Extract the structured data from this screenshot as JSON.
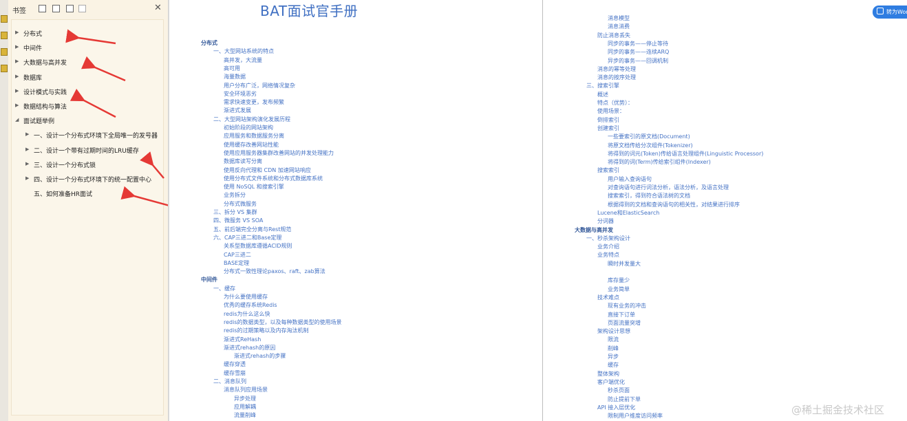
{
  "sidebar": {
    "title": "书签",
    "items": [
      {
        "label": "分布式",
        "expand": "closed",
        "level": 0
      },
      {
        "label": "中间件",
        "expand": "closed",
        "level": 0
      },
      {
        "label": "大数据与高并发",
        "expand": "closed",
        "level": 0
      },
      {
        "label": "数据库",
        "expand": "closed",
        "level": 0
      },
      {
        "label": "设计模式与实践",
        "expand": "closed",
        "level": 0
      },
      {
        "label": "数据结构与算法",
        "expand": "closed",
        "level": 0
      },
      {
        "label": "面试题举例",
        "expand": "open",
        "level": 0
      },
      {
        "label": "一、设计一个分布式环境下全局唯一的发号器",
        "expand": "closed",
        "level": 1
      },
      {
        "label": "二、设计一个带有过期时间的LRU缓存",
        "expand": "closed",
        "level": 1
      },
      {
        "label": "三、设计一个分布式锁",
        "expand": "closed",
        "level": 1
      },
      {
        "label": "四、设计一个分布式环境下的统一配置中心",
        "expand": "closed",
        "level": 1
      },
      {
        "label": "五、如何准备HR面试",
        "expand": "none",
        "level": 1
      }
    ],
    "annotation_color": "#e53935"
  },
  "document": {
    "title": "BAT面试官手册",
    "page1_lines": [
      {
        "text": "分布式",
        "level": 0
      },
      {
        "text": "一、大型网站系统的特点",
        "level": 1
      },
      {
        "text": "高并发，大流量",
        "level": 2
      },
      {
        "text": "高可用",
        "level": 2
      },
      {
        "text": "海量数据",
        "level": 2
      },
      {
        "text": "用户分布广泛，网络情况复杂",
        "level": 2
      },
      {
        "text": "安全环境恶劣",
        "level": 2
      },
      {
        "text": "需求快速变更，发布频繁",
        "level": 2
      },
      {
        "text": "渐进式发展",
        "level": 2
      },
      {
        "text": "二、大型网站架构演化发展历程",
        "level": 1
      },
      {
        "text": "初始阶段的网站架构",
        "level": 2
      },
      {
        "text": "应用服务和数据服务分离",
        "level": 2
      },
      {
        "text": "使用缓存改善网站性能",
        "level": 2
      },
      {
        "text": "使用应用服务器集群改善网站的并发处理能力",
        "level": 2
      },
      {
        "text": "数据库读写分离",
        "level": 2
      },
      {
        "text": "使用反向代理和 CDN 加速网站响应",
        "level": 2
      },
      {
        "text": "使用分布式文件系统和分布式数据库系统",
        "level": 2
      },
      {
        "text": "使用 NoSQL 和搜索引擎",
        "level": 2
      },
      {
        "text": "业务拆分",
        "level": 2
      },
      {
        "text": "分布式微服务",
        "level": 2
      },
      {
        "text": "三、拆分 VS 集群",
        "level": 1
      },
      {
        "text": "四、微服务 VS SOA",
        "level": 1
      },
      {
        "text": "五、前后端完全分离与Rest规范",
        "level": 1
      },
      {
        "text": "六、CAP三进二和Base定理",
        "level": 1
      },
      {
        "text": "关系型数据库遵循ACID规则",
        "level": 2
      },
      {
        "text": "CAP三进二",
        "level": 2
      },
      {
        "text": "BASE定理",
        "level": 2
      },
      {
        "text": "分布式一致性理论paxos、raft、zab算法",
        "level": 2
      },
      {
        "text": "中间件",
        "level": 0
      },
      {
        "text": "一、缓存",
        "level": 1
      },
      {
        "text": "为什么要使用缓存",
        "level": 2
      },
      {
        "text": "优秀的缓存系统Redis",
        "level": 2
      },
      {
        "text": "redis为什么这么快",
        "level": 2
      },
      {
        "text": "redis的数据类型，以及每种数据类型的使用场景",
        "level": 2
      },
      {
        "text": "redis的过期策略以及内存淘汰机制",
        "level": 2
      },
      {
        "text": "渐进式ReHash",
        "level": 2
      },
      {
        "text": "渐进式rehash的原因",
        "level": 2
      },
      {
        "text": "渐进式rehash的步骤",
        "level": 3
      },
      {
        "text": "缓存穿透",
        "level": 2
      },
      {
        "text": "缓存雪崩",
        "level": 2
      },
      {
        "text": "二、消息队列",
        "level": 1
      },
      {
        "text": "消息队列应用场景",
        "level": 2
      },
      {
        "text": "异步处理",
        "level": 3
      },
      {
        "text": "应用解耦",
        "level": 3
      },
      {
        "text": "流量削峰",
        "level": 3
      }
    ],
    "page2_lines": [
      {
        "text": "消息模型",
        "level": 3
      },
      {
        "text": "消息消费",
        "level": 3
      },
      {
        "text": "防止消息丢失",
        "level": 2
      },
      {
        "text": "同步的事务——停止等待",
        "level": 3
      },
      {
        "text": "同步的事务——连续ARQ",
        "level": 3
      },
      {
        "text": "异步的事务——回调机制",
        "level": 3
      },
      {
        "text": "消息的幂等处理",
        "level": 2
      },
      {
        "text": "消息的按序处理",
        "level": 2
      },
      {
        "text": "三、搜索引擎",
        "level": 1
      },
      {
        "text": "概述",
        "level": 2
      },
      {
        "text": "特点（优势）：",
        "level": 2
      },
      {
        "text": "使用场景：",
        "level": 2
      },
      {
        "text": "倒排索引",
        "level": 2
      },
      {
        "text": "创建索引",
        "level": 2
      },
      {
        "text": "一些要索引的原文档(Document)",
        "level": 3
      },
      {
        "text": "将原文档传给分次组件(Tokenizer)",
        "level": 3
      },
      {
        "text": "将得到的词元(Token)传给语言处理组件(Linguistic Processor)",
        "level": 3
      },
      {
        "text": "将得到的词(Term)传给索引组件(Indexer)",
        "level": 3
      },
      {
        "text": "搜索索引",
        "level": 2
      },
      {
        "text": "用户输入查询语句",
        "level": 3
      },
      {
        "text": "对查询语句进行词法分析，语法分析，及语言处理",
        "level": 3
      },
      {
        "text": "搜索索引，得到符合语法树的文档",
        "level": 3
      },
      {
        "text": "根据得到的文档和查询语句的相关性，对结果进行排序",
        "level": 3
      },
      {
        "text": "Lucene和ElasticSearch",
        "level": 2
      },
      {
        "text": "分词器",
        "level": 2
      },
      {
        "text": "大数据与高并发",
        "level": 0
      },
      {
        "text": "一、秒杀架构设计",
        "level": 1
      },
      {
        "text": "业务介绍",
        "level": 2
      },
      {
        "text": "业务特点",
        "level": 2
      },
      {
        "text": "瞬时并发量大",
        "level": 3
      },
      {
        "text": "",
        "level": 3
      },
      {
        "text": "库存量少",
        "level": 3
      },
      {
        "text": "业务简单",
        "level": 3
      },
      {
        "text": "技术难点",
        "level": 2
      },
      {
        "text": "现有业务的冲击",
        "level": 3
      },
      {
        "text": "直接下订单",
        "level": 3
      },
      {
        "text": "页面流量突增",
        "level": 3
      },
      {
        "text": "架构设计思想",
        "level": 2
      },
      {
        "text": "限流",
        "level": 3
      },
      {
        "text": "削峰",
        "level": 3
      },
      {
        "text": "异步",
        "level": 3
      },
      {
        "text": "缓存",
        "level": 3
      },
      {
        "text": "整体架构",
        "level": 2
      },
      {
        "text": "客户端优化",
        "level": 2
      },
      {
        "text": "秒杀页面",
        "level": 3
      },
      {
        "text": "防止提前下单",
        "level": 3
      },
      {
        "text": "API 接入层优化",
        "level": 2
      },
      {
        "text": "限制用户维度访问频率",
        "level": 3
      }
    ]
  },
  "convert_button": {
    "label": "转为Word"
  },
  "watermark": "@稀土掘金技术社区"
}
